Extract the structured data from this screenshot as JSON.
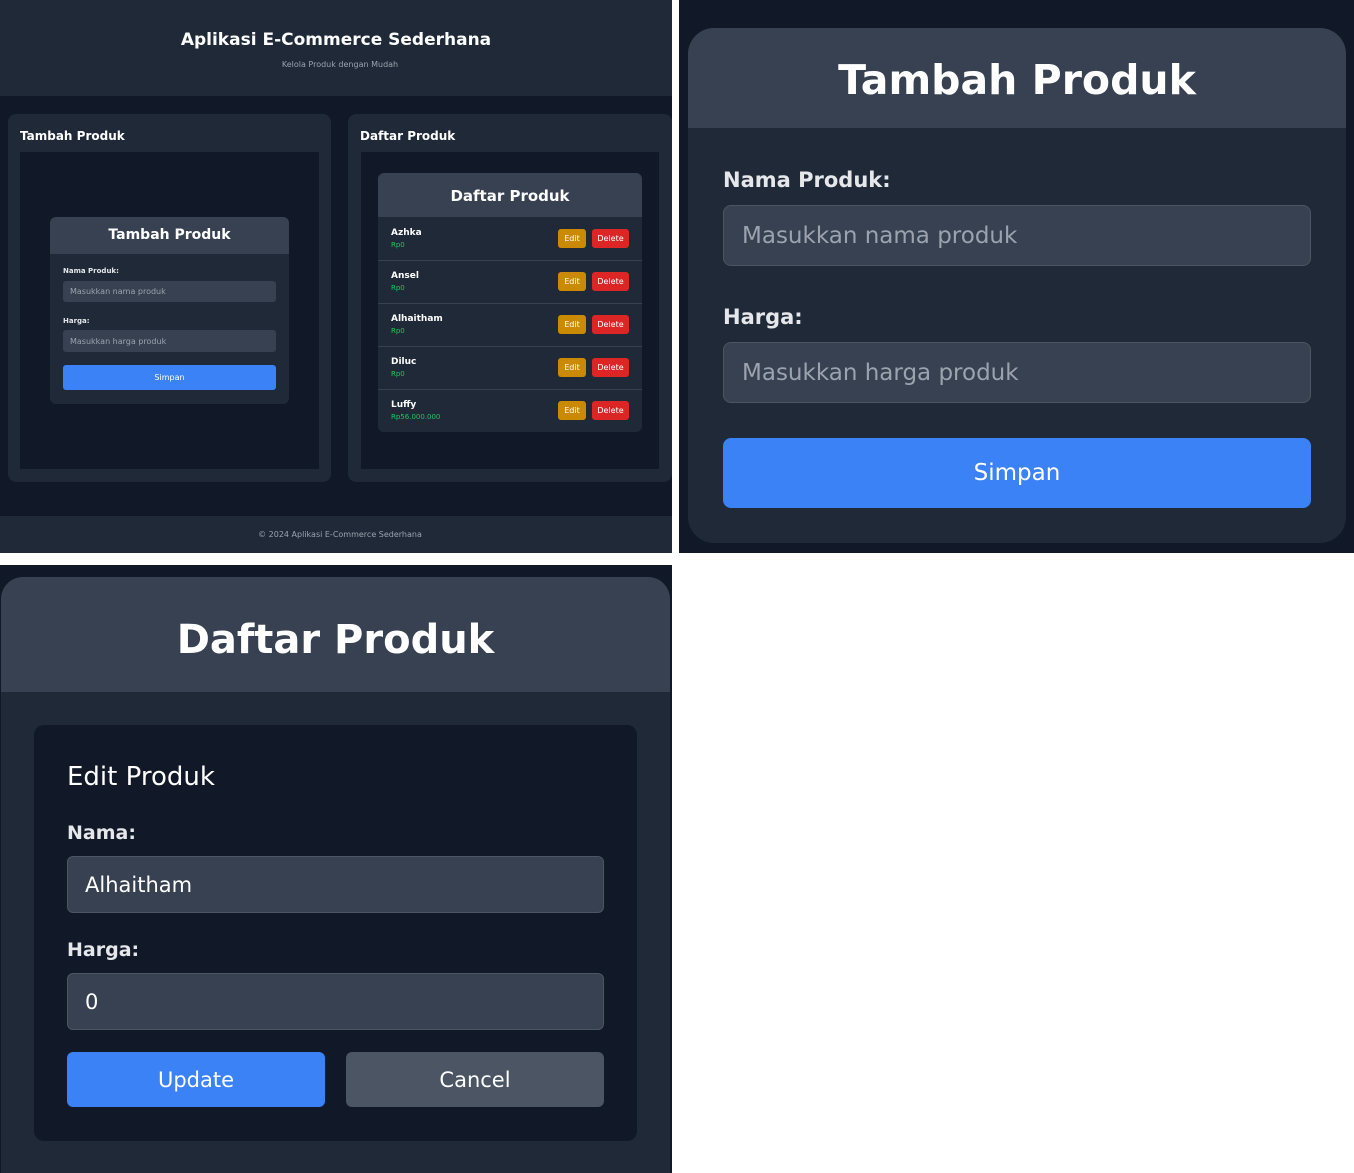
{
  "app": {
    "title": "Aplikasi E-Commerce Sederhana",
    "subtitle": "Kelola Produk dengan Mudah",
    "footer": "© 2024 Aplikasi E-Commerce Sederhana"
  },
  "add_section": {
    "card_title": "Tambah Produk",
    "form_title": "Tambah Produk",
    "name_label": "Nama Produk:",
    "name_placeholder": "Masukkan nama produk",
    "price_label": "Harga:",
    "price_placeholder": "Masukkan harga produk",
    "submit_label": "Simpan"
  },
  "list_section": {
    "card_title": "Daftar Produk",
    "list_title": "Daftar Produk",
    "edit_label": "Edit",
    "delete_label": "Delete",
    "products": [
      {
        "name": "Azhka",
        "price": "Rp0"
      },
      {
        "name": "Ansel",
        "price": "Rp0"
      },
      {
        "name": "Alhaitham",
        "price": "Rp0"
      },
      {
        "name": "Diluc",
        "price": "Rp0"
      },
      {
        "name": "Luffy",
        "price": "Rp56.000.000"
      }
    ]
  },
  "edit_form": {
    "section_title": "Daftar Produk",
    "title": "Edit Produk",
    "name_label": "Nama:",
    "name_value": "Alhaitham",
    "price_label": "Harga:",
    "price_value": "0",
    "update_label": "Update",
    "cancel_label": "Cancel"
  },
  "colors": {
    "background": "#111827",
    "surface": "#1f2937",
    "surface_header": "#374151",
    "primary": "#3b82f6",
    "edit": "#ca8a04",
    "delete": "#dc2626",
    "price": "#22c55e",
    "cancel": "#4b5563"
  }
}
